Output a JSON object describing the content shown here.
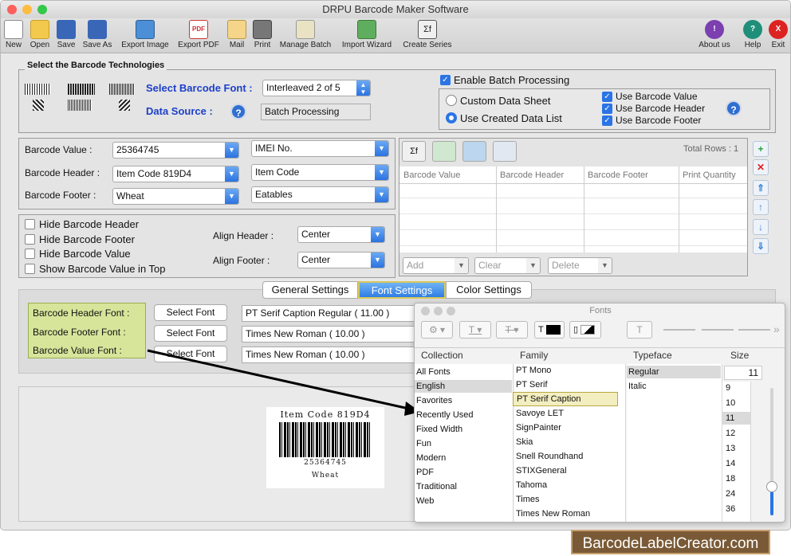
{
  "window": {
    "title": "DRPU Barcode Maker Software"
  },
  "toolbar": {
    "new": "New",
    "open": "Open",
    "save": "Save",
    "save_as": "Save As",
    "export_image": "Export Image",
    "export_pdf": "Export PDF",
    "mail": "Mail",
    "print": "Print",
    "manage_batch": "Manage Batch",
    "import_wizard": "Import Wizard",
    "create_series": "Create Series",
    "about_us": "About us",
    "help": "Help",
    "exit": "Exit",
    "pdf_icon_text": "PDF",
    "sigma_icon_text": "Σf",
    "about_glyph": "!",
    "help_glyph": "?",
    "exit_glyph": "X"
  },
  "tech": {
    "title": "Select the Barcode Technologies",
    "font_label": "Select Barcode Font :",
    "font_value": "Interleaved 2 of 5",
    "source_label": "Data Source :",
    "source_value": "Batch Processing",
    "help_glyph": "?"
  },
  "batch": {
    "enable_label": "Enable Batch Processing",
    "custom_label": "Custom Data Sheet",
    "created_label": "Use Created Data List",
    "use_value": "Use Barcode Value",
    "use_header": "Use Barcode Header",
    "use_footer": "Use Barcode Footer",
    "help_glyph": "?"
  },
  "fields": {
    "value_label": "Barcode Value :",
    "value": "25364745",
    "value_type": "IMEI No.",
    "header_label": "Barcode Header :",
    "header": "Item Code 819D4",
    "header_type": "Item Code",
    "footer_label": "Barcode Footer :",
    "footer": "Wheat",
    "footer_type": "Eatables"
  },
  "options": {
    "hide_header": "Hide Barcode Header",
    "hide_footer": "Hide Barcode Footer",
    "hide_value": "Hide Barcode Value",
    "show_top": "Show Barcode Value in Top",
    "align_header_label": "Align Header :",
    "align_header": "Center",
    "align_footer_label": "Align Footer :",
    "align_footer": "Center"
  },
  "grid": {
    "total_rows": "Total Rows : 1",
    "columns": [
      "Barcode Value",
      "Barcode Header",
      "Barcode Footer",
      "Print Quantity"
    ],
    "add": "Add",
    "clear": "Clear",
    "delete": "Delete",
    "icon_sigma": "Σf",
    "side_add": "+",
    "side_remove": "✕",
    "side_up_top": "⇑",
    "side_up": "↑",
    "side_down": "↓",
    "side_down_bottom": "⇓"
  },
  "tabs": {
    "general": "General Settings",
    "font": "Font Settings",
    "color": "Color Settings"
  },
  "font_settings": {
    "header_label": "Barcode Header Font :",
    "footer_label": "Barcode Footer Font :",
    "value_label": "Barcode Value Font :",
    "select_font": "Select Font",
    "header_font": "PT Serif Caption Regular ( 11.00 )",
    "footer_font": "Times New Roman ( 10.00 )",
    "value_font": "Times New Roman ( 10.00 )"
  },
  "preview": {
    "header": "Item Code 819D4",
    "value": "25364745",
    "footer": "Wheat"
  },
  "fonts_panel": {
    "title": "Fonts",
    "tool_underline": "T",
    "tool_strike": "T",
    "tool_text_color": "T",
    "tool_doc": "T",
    "overflow": "»",
    "collection_head": "Collection",
    "family_head": "Family",
    "typeface_head": "Typeface",
    "size_head": "Size",
    "collection": [
      "All Fonts",
      "English",
      "Favorites",
      "Recently Used",
      "Fixed Width",
      "Fun",
      "Modern",
      "PDF",
      "Traditional",
      "Web"
    ],
    "family": [
      "PT Mono",
      "PT Serif",
      "PT Serif Caption",
      "Savoye LET",
      "SignPainter",
      "Skia",
      "Snell Roundhand",
      "STIXGeneral",
      "Tahoma",
      "Times",
      "Times New Roman"
    ],
    "typeface": [
      "Regular",
      "Italic"
    ],
    "size_value": "11",
    "sizes": [
      "9",
      "10",
      "11",
      "12",
      "13",
      "14",
      "18",
      "24",
      "36"
    ]
  },
  "watermark": "BarcodeLabelCreator.com"
}
